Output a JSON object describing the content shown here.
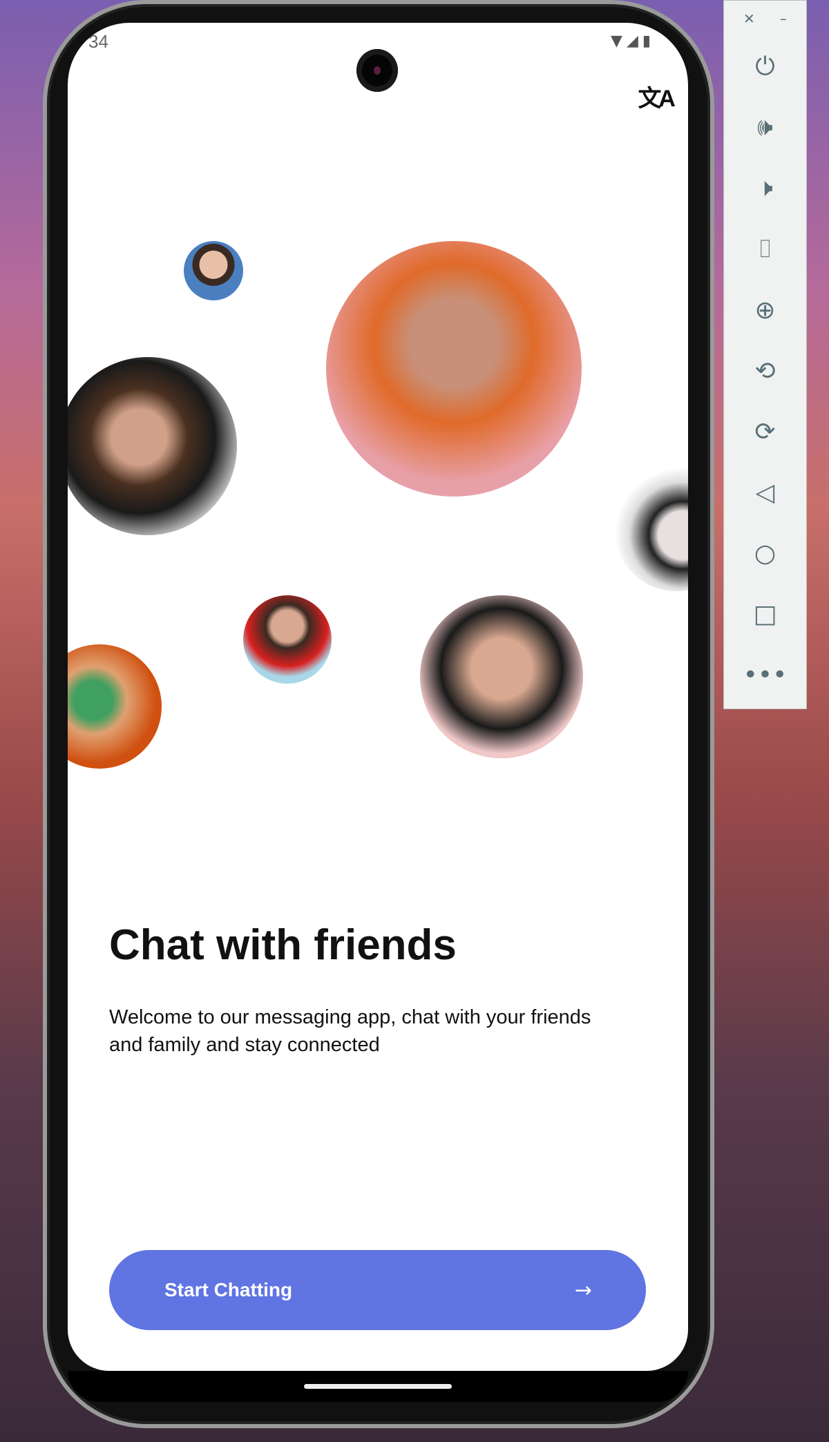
{
  "status_bar": {
    "time": "34"
  },
  "onboarding": {
    "title": "Chat with friends",
    "description": "Welcome to our messaging app, chat with your friends and family and stay connected",
    "button_label": "Start Chatting",
    "accent_color": "#6074e2"
  },
  "avatars": [
    "woman-smiling",
    "man-orange-hoodie-sunglasses",
    "bearded-man",
    "face-paint-woman",
    "man-red-shirt",
    "man-sunglasses-black-jacket",
    "woman-green-eye-makeup"
  ],
  "emulator_toolbar": {
    "icons": [
      "power-icon",
      "volume-up-icon",
      "volume-down-icon",
      "camera-icon",
      "zoom-icon",
      "rotate-left-icon",
      "rotate-right-icon",
      "back-icon",
      "home-icon",
      "overview-icon",
      "more-icon"
    ]
  }
}
